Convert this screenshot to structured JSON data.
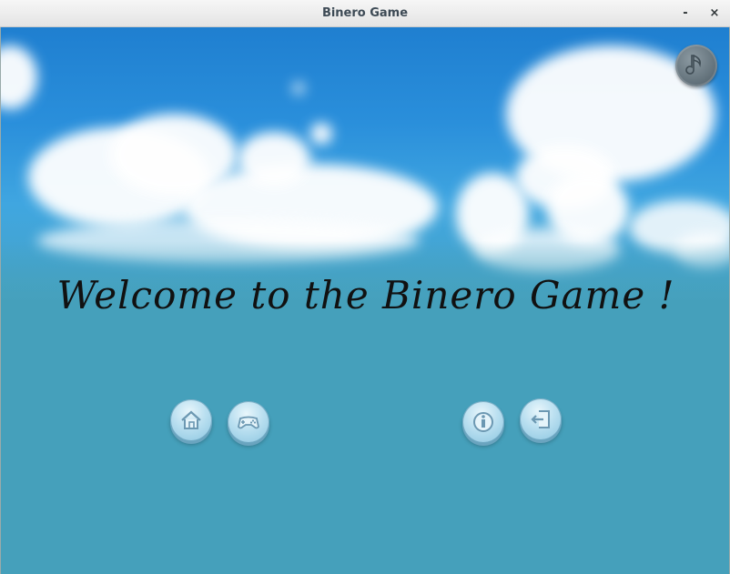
{
  "window": {
    "title": "Binero Game",
    "minimize_label": "-",
    "close_label": "×"
  },
  "main": {
    "welcome_text": "Welcome to the Binero Game !"
  },
  "controls": {
    "music_icon": "music-note-icon",
    "home_icon": "home-icon",
    "play_icon": "gamepad-icon",
    "info_icon": "info-icon",
    "exit_icon": "exit-icon"
  },
  "colors": {
    "sky": "#2a8fdb",
    "ground": "#45a0bb",
    "button": "#b9dff0",
    "music_button": "#5f6e77"
  }
}
